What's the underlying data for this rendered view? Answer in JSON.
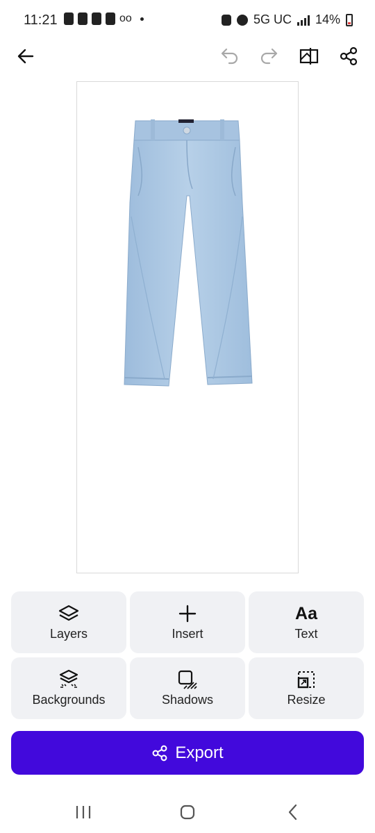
{
  "status_bar": {
    "time": "11:21",
    "network": "5G UC",
    "battery": "14%"
  },
  "toolbar": {
    "icons": [
      "arrow-left-icon",
      "undo-icon",
      "redo-icon",
      "compare-icon",
      "share-icon"
    ]
  },
  "canvas": {
    "image_subject": "light-wash denim jeans"
  },
  "tools": [
    {
      "label": "Layers",
      "icon": "layers-icon"
    },
    {
      "label": "Insert",
      "icon": "plus-icon"
    },
    {
      "label": "Text",
      "icon_text": "Aa"
    },
    {
      "label": "Backgrounds",
      "icon": "backgrounds-icon"
    },
    {
      "label": "Shadows",
      "icon": "shadows-icon"
    },
    {
      "label": "Resize",
      "icon": "resize-icon"
    }
  ],
  "export": {
    "label": "Export"
  },
  "colors": {
    "accent": "#4209dc",
    "tool_bg": "#f0f1f4",
    "denim": "#a9c6e2"
  }
}
